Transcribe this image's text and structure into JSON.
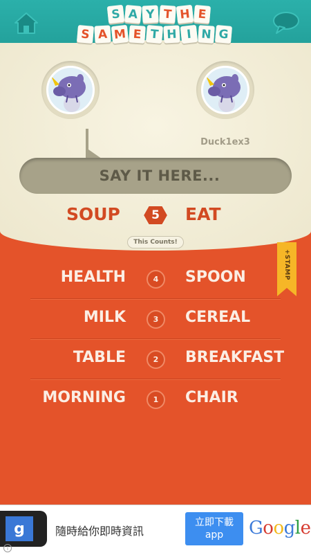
{
  "header": {
    "logo_line1": [
      "S",
      "A",
      "Y",
      "T",
      "H",
      "E"
    ],
    "logo_line2": [
      "S",
      "A",
      "M",
      "E",
      "T",
      "H",
      "I",
      "N",
      "G"
    ],
    "home_icon": "home-icon",
    "chat_icon": "speech-bubble-icon",
    "brand_teal": "#2bb0aa",
    "brand_red": "#e4532a"
  },
  "players": {
    "opponent_name": "Duck1ex3",
    "avatar_icon": "rhino-avatar"
  },
  "input": {
    "placeholder": "SAY IT HERE..."
  },
  "current_round": {
    "left_word": "SOUP",
    "right_word": "EAT",
    "round": "5",
    "counts_label": "This Counts!"
  },
  "history": [
    {
      "left": "HEALTH",
      "num": "4",
      "right": "SPOON"
    },
    {
      "left": "MILK",
      "num": "3",
      "right": "CEREAL"
    },
    {
      "left": "TABLE",
      "num": "2",
      "right": "BREAKFAST"
    },
    {
      "left": "MORNING",
      "num": "1",
      "right": "CHAIR"
    }
  ],
  "stamp": {
    "label": "+STAMP"
  },
  "ad": {
    "text": "隨時給你即時資訊",
    "button_line1": "立即下載",
    "button_line2": "app",
    "brand": "Google",
    "phone_glyph": "g",
    "info": "i"
  }
}
